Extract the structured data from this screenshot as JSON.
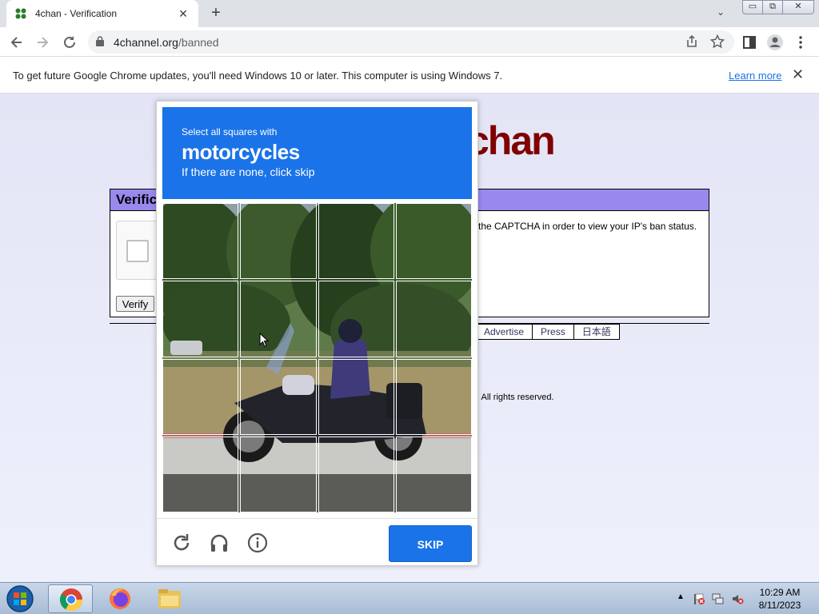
{
  "browser": {
    "tab_title": "4chan - Verification",
    "tab_close": "✕",
    "new_tab": "+",
    "tab_menu": "⌄",
    "url_host": "4channel.org",
    "url_path": "/banned",
    "window_min": "▭",
    "window_max": "⧉",
    "window_close": "✕"
  },
  "infobar": {
    "message": "To get future Google Chrome updates, you'll need Windows 10 or later. This computer is using Windows 7.",
    "link": "Learn more",
    "close": "✕"
  },
  "page": {
    "logo": "chan",
    "box_title": "Verific",
    "box_text": "the CAPTCHA in order to view your IP's ban status.",
    "verify_button": "Verify",
    "nav_links": [
      "Advertise",
      "Press",
      "日本語"
    ],
    "copyright": ". All rights reserved.",
    "dot": ":"
  },
  "captcha": {
    "instruction": "Select all squares with",
    "target": "motorcycles",
    "hint": "If there are none, click skip",
    "skip": "SKIP"
  },
  "taskbar": {
    "time": "10:29 AM",
    "date": "8/11/2023",
    "tray_arrow": "▲"
  }
}
